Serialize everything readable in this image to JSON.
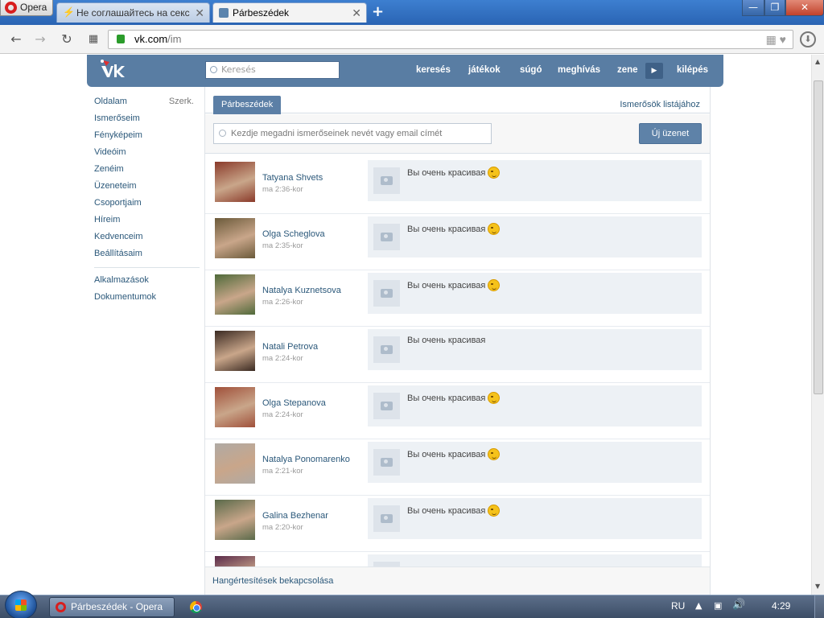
{
  "browser": {
    "menu_label": "Opera",
    "tabs": [
      {
        "title": "Не соглашайтесь на секс",
        "state": "inactive"
      },
      {
        "title": "Párbeszédek",
        "state": "active"
      }
    ],
    "new_tab_glyph": "+",
    "address": {
      "domain": "vk.com",
      "path": "/im"
    },
    "controls": {
      "minimize": "—",
      "maximize": "❐",
      "close": "✕"
    }
  },
  "header": {
    "search_placeholder": "Keresés",
    "links": [
      "keresés",
      "játékok",
      "súgó",
      "meghívás",
      "zene",
      "kilépés"
    ]
  },
  "sidebar": {
    "items": [
      {
        "label": "Oldalam",
        "extra": "Szerk."
      },
      {
        "label": "Ismerőseim"
      },
      {
        "label": "Fényképeim"
      },
      {
        "label": "Videóim"
      },
      {
        "label": "Zenéim"
      },
      {
        "label": "Üzeneteim"
      },
      {
        "label": "Csoportjaim"
      },
      {
        "label": "Híreim"
      },
      {
        "label": "Kedvenceim"
      },
      {
        "label": "Beállításaim"
      }
    ],
    "secondary": [
      {
        "label": "Alkalmazások"
      },
      {
        "label": "Dokumentumok"
      }
    ]
  },
  "messages": {
    "tab_label": "Párbeszédek",
    "friends_list_link": "Ismerősök listájához",
    "recipient_placeholder": "Kezdje megadni ismerőseinek nevét vagy email címét",
    "new_message_button": "Új üzenet",
    "dialogs": [
      {
        "name": "Tatyana Shvets",
        "time": "ma 2:36-kor",
        "text": "Вы очень красивая",
        "emoji": true,
        "avatar_color": "#8a3a2a"
      },
      {
        "name": "Olga Scheglova",
        "time": "ma 2:35-kor",
        "text": "Вы очень красивая",
        "emoji": true,
        "avatar_color": "#6b5a3a"
      },
      {
        "name": "Natalya Kuznetsova",
        "time": "ma 2:26-kor",
        "text": "Вы очень красивая",
        "emoji": true,
        "avatar_color": "#4f6a3a"
      },
      {
        "name": "Natali Petrova",
        "time": "ma 2:24-kor",
        "text": "Вы очень красивая",
        "emoji": false,
        "avatar_color": "#3a2a22"
      },
      {
        "name": "Olga Stepanova",
        "time": "ma 2:24-kor",
        "text": "Вы очень красивая",
        "emoji": true,
        "avatar_color": "#a0503a"
      },
      {
        "name": "Natalya Ponomarenko",
        "time": "ma 2:21-kor",
        "text": "Вы очень красивая",
        "emoji": true,
        "avatar_color": "#b0aaa4"
      },
      {
        "name": "Galina Bezhenar",
        "time": "ma 2:20-kor",
        "text": "Вы очень красивая",
        "emoji": true,
        "avatar_color": "#5a6a4a"
      },
      {
        "name": "",
        "time": "",
        "text": "",
        "emoji": false,
        "avatar_color": "#5a2a4a"
      }
    ],
    "notifications_toggle": "Hangértesítések bekapcsolása"
  },
  "taskbar": {
    "opera_task": "Párbeszédek - Opera",
    "language": "RU",
    "clock": "4:29"
  },
  "colors": {
    "vk_blue": "#597da3",
    "link": "#2b587a",
    "message_bg": "#edf1f5"
  }
}
